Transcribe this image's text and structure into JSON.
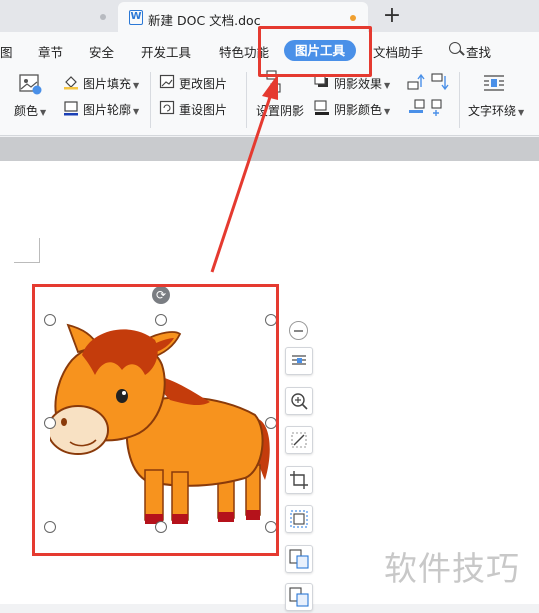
{
  "tabs": {
    "active_title": "新建 DOC 文档.doc",
    "doc_badge": "W",
    "new_tab_symbol": "+"
  },
  "menu": {
    "items": [
      "图",
      "章节",
      "安全",
      "开发工具",
      "特色功能",
      "图片工具",
      "文档助手",
      "查找"
    ],
    "active": "图片工具"
  },
  "ribbon": {
    "color_label": "颜色",
    "fill_label": "图片填充",
    "outline_label": "图片轮廓",
    "change_label": "更改图片",
    "reset_label": "重设图片",
    "set_shadow_label": "设置阴影",
    "shadow_effect_label": "阴影效果",
    "shadow_color_label": "阴影颜色",
    "wrap_label": "文字环绕"
  },
  "watermark": "软件技巧",
  "colors": {
    "accent": "#4a90e8",
    "highlight": "#e53a30",
    "horse_body": "#f7931e",
    "horse_mane": "#c43c0c"
  }
}
